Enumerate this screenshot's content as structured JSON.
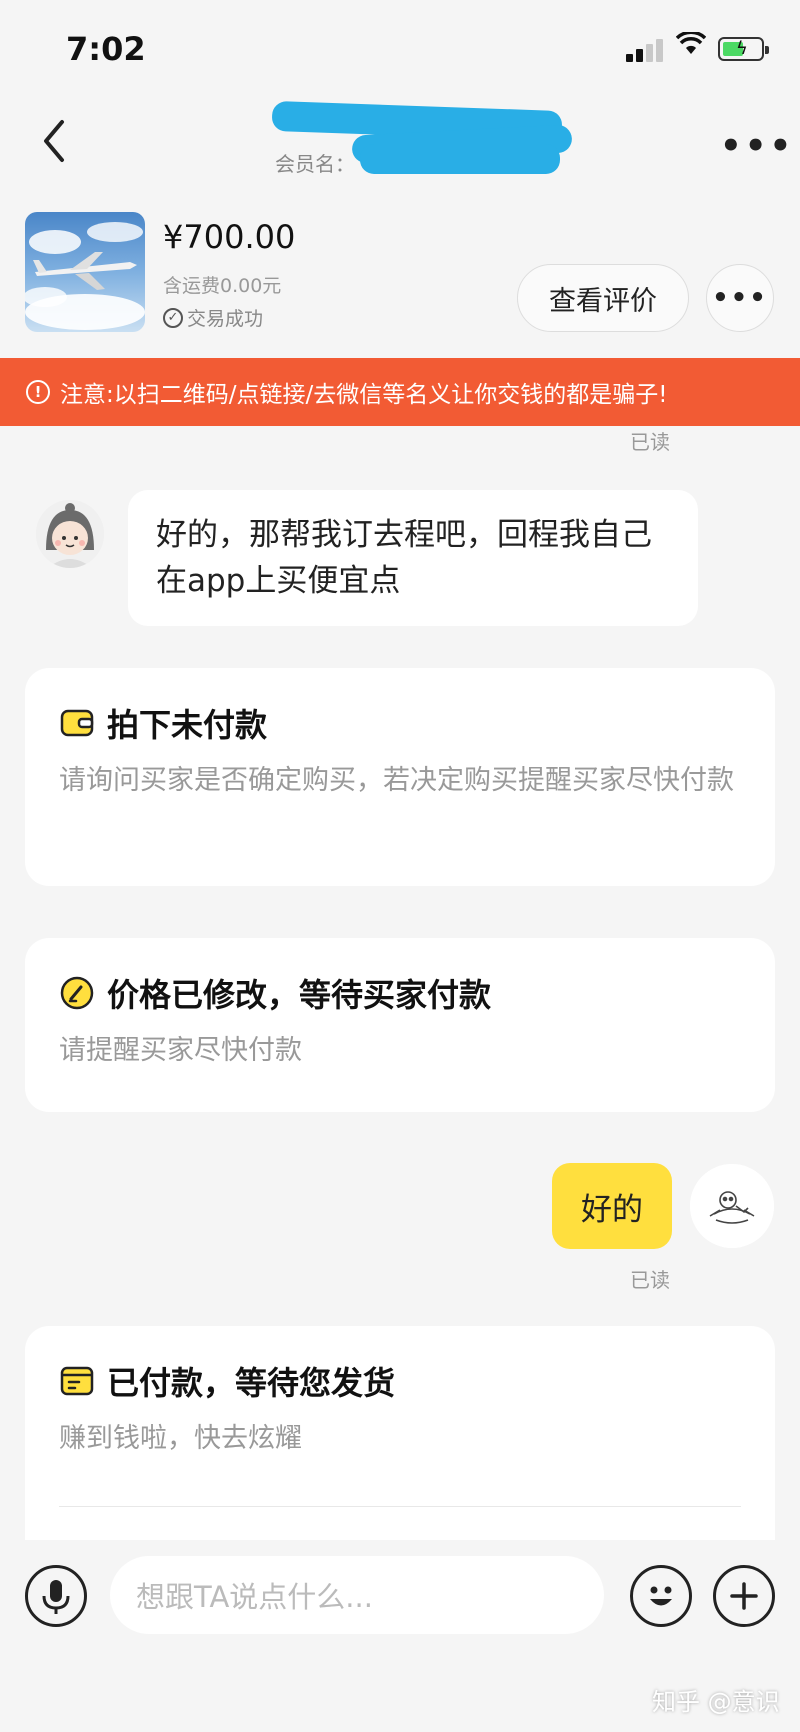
{
  "status_bar": {
    "time": "7:02"
  },
  "header": {
    "member_label": "会员名："
  },
  "product": {
    "price": "¥700.00",
    "shipping": "含运费0.00元",
    "status": "交易成功",
    "review_button": "查看评价"
  },
  "warning": {
    "text": "注意:以扫二维码/点链接/去微信等名义让你交钱的都是骗子!"
  },
  "messages": {
    "read_label": "已读",
    "left_message": "好的，那帮我订去程吧，回程我自己在app上买便宜点",
    "right_message": "好的"
  },
  "cards": [
    {
      "title": "拍下未付款",
      "desc": "请询问买家是否确定购买，若决定购买提醒买家尽快付款"
    },
    {
      "title": "价格已修改，等待买家付款",
      "desc": "请提醒买家尽快付款"
    },
    {
      "title": "已付款，等待您发货",
      "desc": "赚到钱啦，快去炫耀"
    }
  ],
  "input": {
    "placeholder": "想跟TA说点什么..."
  },
  "watermark": "知乎 @意识",
  "colors": {
    "accent_yellow": "#ffdf3e",
    "warning_orange": "#f25b34",
    "redaction_blue": "#29aee6"
  }
}
